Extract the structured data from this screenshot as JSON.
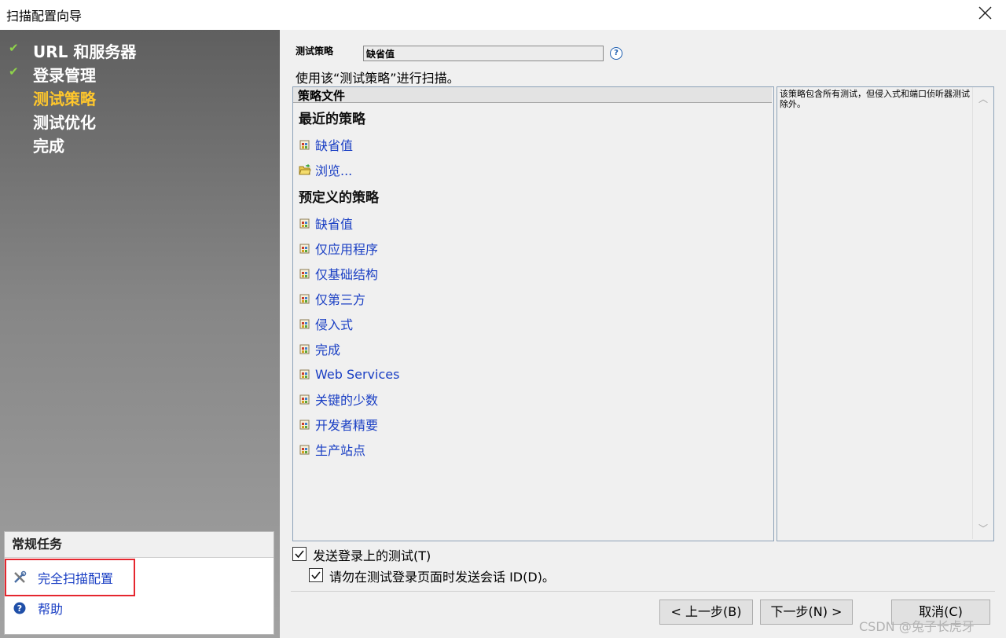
{
  "window": {
    "title": "扫描配置向导"
  },
  "steps": [
    {
      "label": "URL 和服务器",
      "done": true
    },
    {
      "label": "登录管理",
      "done": true
    },
    {
      "label": "测试策略",
      "active": true
    },
    {
      "label": "测试优化"
    },
    {
      "label": "完成"
    }
  ],
  "tasks": {
    "header": "常规任务",
    "items": [
      {
        "label": "完全扫描配置",
        "icon": "tools-icon"
      },
      {
        "label": "帮助",
        "icon": "help-icon"
      }
    ]
  },
  "policy": {
    "label": "测试策略",
    "value": "缺省值",
    "hint": "使用该“测试策略”进行扫描。"
  },
  "list": {
    "header": "策略文件",
    "recent_title": "最近的策略",
    "recent": [
      "缺省值",
      "浏览..."
    ],
    "predefined_title": "预定义的策略",
    "predefined": [
      "缺省值",
      "仅应用程序",
      "仅基础结构",
      "仅第三方",
      "侵入式",
      "完成",
      "Web Services",
      "关键的少数",
      "开发者精要",
      "生产站点"
    ]
  },
  "description": "该策略包含所有测试，但侵入式和端口侦听器测试除外。",
  "options": {
    "send_login_tests": "发送登录上的测试(T)",
    "send_login_tests_checked": true,
    "no_session_id": "请勿在测试登录页面时发送会话 ID(D)。",
    "no_session_id_checked": true
  },
  "buttons": {
    "back": "< 上一步(B)",
    "next": "下一步(N) >",
    "cancel": "取消(C)"
  },
  "watermark": "CSDN @兔子长虎牙",
  "colors": {
    "active_step": "#ffc72c",
    "link": "#1a3fc4",
    "highlight_box": "#e5262e",
    "check": "#8fd34a"
  }
}
